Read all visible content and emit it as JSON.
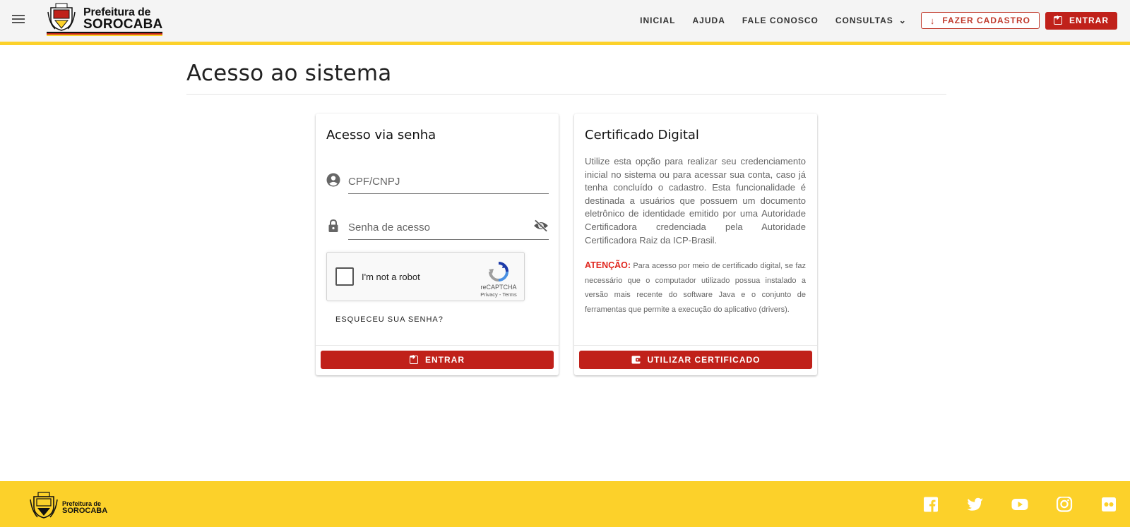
{
  "header": {
    "logo_line1": "Prefeitura de",
    "logo_line2": "SOROCABA",
    "nav": [
      {
        "label": "INICIAL"
      },
      {
        "label": "AJUDA"
      },
      {
        "label": "FALE CONOSCO"
      },
      {
        "label": "CONSULTAS"
      }
    ],
    "register_label": "FAZER CADASTRO",
    "login_label": "ENTRAR"
  },
  "page": {
    "title": "Acesso ao sistema"
  },
  "password_card": {
    "title": "Acesso via senha",
    "cpf_placeholder": "CPF/CNPJ",
    "password_placeholder": "Senha de acesso",
    "captcha_label": "I'm not a robot",
    "captcha_brand": "reCAPTCHA",
    "captcha_terms": "Privacy - Terms",
    "forgot_label": "ESQUECEU SUA SENHA?",
    "submit_label": "ENTRAR"
  },
  "certificate_card": {
    "title": "Certificado Digital",
    "description": "Utilize esta opção para realizar seu credenciamento inicial no sistema ou para acessar sua conta, caso já tenha concluído o cadastro. Esta funcionalidade é destinada a usuários que possuem um documento eletrônico de identidade emitido por uma Autoridade Certificadora credenciada pela Autoridade Certificadora Raiz da ICP-Brasil.",
    "attention_label": "ATENÇÃO:",
    "attention_text": " Para acesso por meio de certificado digital, se faz necessário que o computador utilizado possua instalado a versão mais recente do software Java e o conjunto de ferramentas que permite a execução do aplicativo (drivers).",
    "submit_label": "UTILIZAR CERTIFICADO"
  },
  "footer": {
    "logo_line1": "Prefeitura de",
    "logo_line2": "SOROCABA",
    "socials": [
      "facebook-icon",
      "twitter-icon",
      "youtube-icon",
      "instagram-icon",
      "flickr-icon"
    ]
  },
  "colors": {
    "brand_yellow": "#fcd12a",
    "brand_red": "#c0211a",
    "attention_red": "#e0261e"
  }
}
